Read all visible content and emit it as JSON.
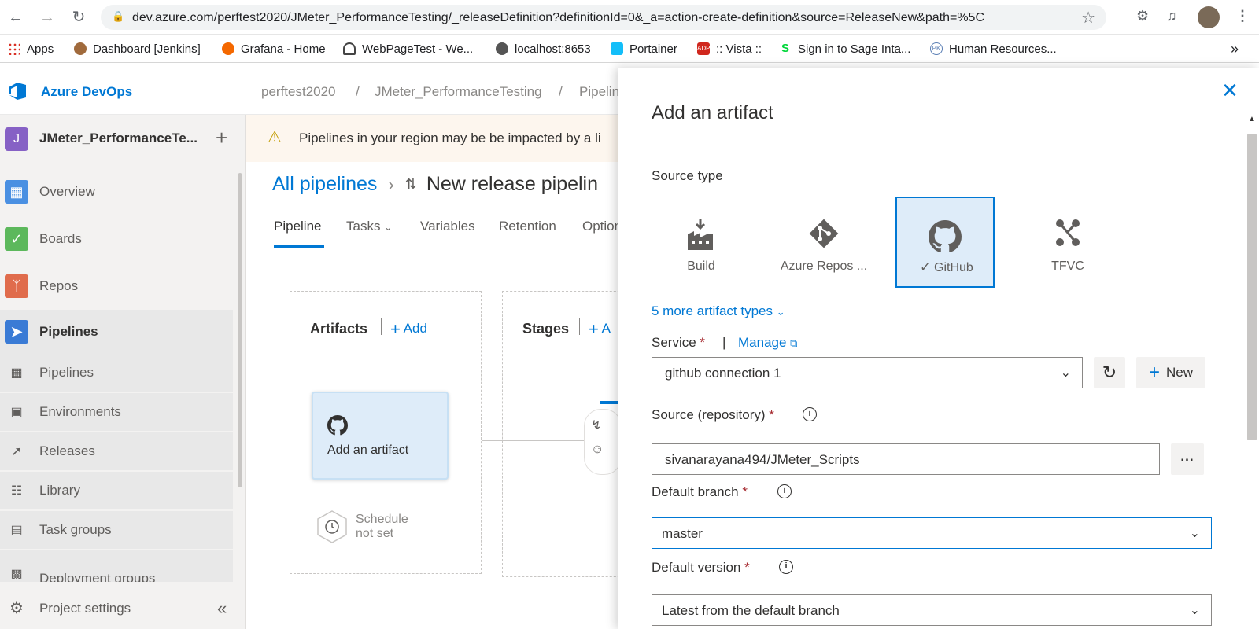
{
  "browser": {
    "url": "dev.azure.com/perftest2020/JMeter_PerformanceTesting/_releaseDefinition?definitionId=0&_a=action-create-definition&source=ReleaseNew&path=%5C"
  },
  "bookmarks": [
    {
      "label": "Apps",
      "icon": "apps-grid-icon",
      "color": "#d93025"
    },
    {
      "label": "Dashboard [Jenkins]",
      "icon": "jenkins-icon",
      "color": "#a06a3c"
    },
    {
      "label": "Grafana - Home",
      "icon": "grafana-icon",
      "color": "#f46800"
    },
    {
      "label": "WebPageTest - We...",
      "icon": "speedometer-icon",
      "color": "#444444"
    },
    {
      "label": "localhost:8653",
      "icon": "globe-icon",
      "color": "#555555"
    },
    {
      "label": "Portainer",
      "icon": "portainer-icon",
      "color": "#13bef9"
    },
    {
      "label": ":: Vista ::",
      "icon": "adp-icon",
      "color": "#d0271d"
    },
    {
      "label": "Sign in to Sage Inta...",
      "icon": "sage-icon",
      "color": "#00d639"
    },
    {
      "label": "Human Resources...",
      "icon": "pk-icon",
      "color": "#5b7fb5"
    }
  ],
  "header": {
    "brand": "Azure DevOps",
    "breadcrumbs": [
      "perftest2020",
      "/",
      "JMeter_PerformanceTesting",
      "/",
      "Pipelin"
    ]
  },
  "sidebar": {
    "project_initial": "J",
    "project_name": "JMeter_PerformanceTe...",
    "items": [
      {
        "label": "Overview",
        "color": "#4a90e2"
      },
      {
        "label": "Boards",
        "color": "#5cb85c"
      },
      {
        "label": "Repos",
        "color": "#e06c4c"
      },
      {
        "label": "Pipelines",
        "color": "#3a7bd5"
      }
    ],
    "sub_items": [
      "Pipelines",
      "Environments",
      "Releases",
      "Library",
      "Task groups",
      "Deployment groups"
    ],
    "settings": "Project settings"
  },
  "main": {
    "banner": "Pipelines in your region may be be impacted by a li",
    "all_pipelines": "All pipelines",
    "title": "New release pipelin",
    "tabs": [
      "Pipeline",
      "Tasks",
      "Variables",
      "Retention",
      "Option"
    ],
    "artifacts_title": "Artifacts",
    "artifacts_add": "Add",
    "stages_title": "Stages",
    "stages_add": "A",
    "artifact_card": "Add an artifact",
    "schedule": [
      "Schedule",
      "not set"
    ]
  },
  "panel": {
    "title": "Add an artifact",
    "source_type_label": "Source type",
    "source_types": [
      "Build",
      "Azure Repos ...",
      "GitHub",
      "TFVC"
    ],
    "selected_source": "GitHub",
    "more_types": "5 more artifact types",
    "service_label": "Service",
    "manage": "Manage",
    "service_value": "github connection 1",
    "new_button": "New",
    "source_repo_label": "Source (repository)",
    "source_repo_value": "sivanarayana494/JMeter_Scripts",
    "more_button": "...",
    "default_branch_label": "Default branch",
    "default_branch_value": "master",
    "default_version_label": "Default version",
    "default_version_value": "Latest from the default branch",
    "required_mark": "*"
  }
}
